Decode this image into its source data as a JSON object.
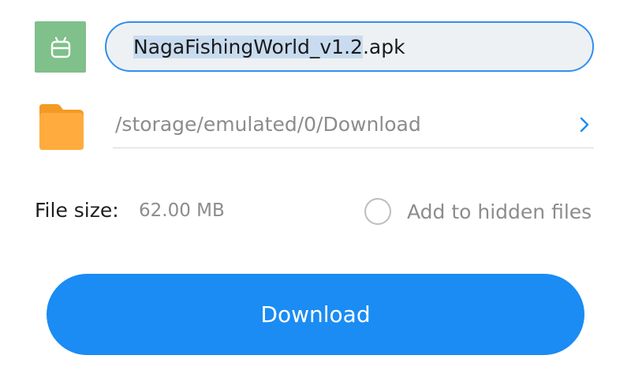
{
  "file": {
    "name_selected": "NagaFishingWorld_v1.2",
    "name_extension": ".apk"
  },
  "path": {
    "location": "/storage/emulated/0/Download"
  },
  "size": {
    "label": "File size:",
    "value": "62.00 MB"
  },
  "hidden_option": {
    "label": "Add to hidden files",
    "checked": false
  },
  "actions": {
    "download_label": "Download"
  },
  "icons": {
    "apk": "android-apk-icon",
    "folder": "folder-icon",
    "chevron": "chevron-right-icon"
  },
  "colors": {
    "accent": "#1a8cf3",
    "field_border": "#2f8ff0",
    "apk_icon_bg": "#7fc08b",
    "folder": "#ffa938"
  }
}
